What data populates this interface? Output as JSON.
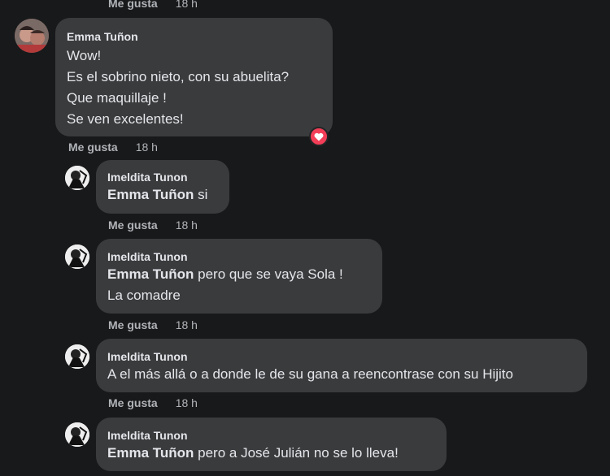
{
  "common": {
    "like_label": "Me gusta"
  },
  "top_meta": {
    "like_label": "Me gusta",
    "time": "18 h"
  },
  "comments": [
    {
      "author": "Emma Tuñon",
      "lines": [
        "Wow!",
        "Es el sobrino nieto, con su abuelita?",
        "Que maquillaje !",
        "Se ven excelentes!"
      ],
      "reaction": "heart-icon",
      "like_label": "Me gusta",
      "time": "18 h"
    },
    {
      "author": "Imeldita Tunon",
      "mention": "Emma Tuñon",
      "lines": [
        " si"
      ],
      "like_label": "Me gusta",
      "time": "18 h"
    },
    {
      "author": "Imeldita Tunon",
      "mention": "Emma Tuñon",
      "lines": [
        " pero que se vaya Sola !",
        "La comadre"
      ],
      "like_label": "Me gusta",
      "time": "18 h"
    },
    {
      "author": "Imeldita Tunon",
      "lines": [
        "A el más allá o a donde le de su gana a reencontrase con su Hijito"
      ],
      "like_label": "Me gusta",
      "time": "18 h"
    },
    {
      "author": "Imeldita Tunon",
      "mention": "Emma Tuñon",
      "lines": [
        " pero a José Julián no se lo lleva!"
      ]
    }
  ],
  "colors": {
    "background": "#18191a",
    "bubble": "#3a3b3c",
    "heart": "#f33e58"
  }
}
